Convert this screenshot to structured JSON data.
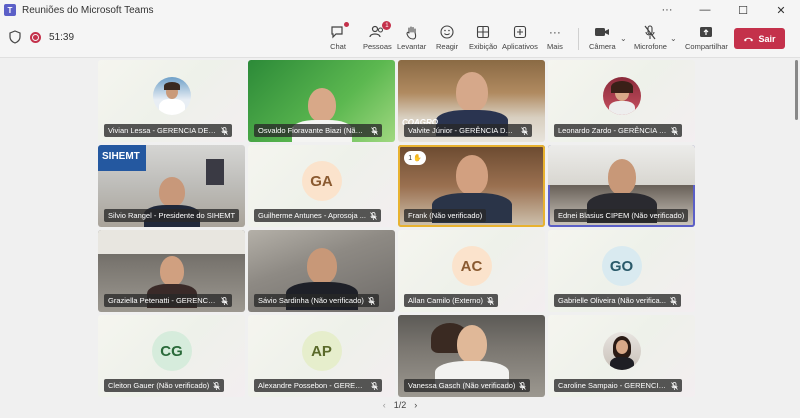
{
  "window": {
    "title": "Reuniões do Microsoft Teams",
    "app_icon": "teams-icon"
  },
  "toolbar": {
    "timer": "51:39",
    "items": [
      {
        "label": "Chat",
        "icon": "chat-icon"
      },
      {
        "label": "Pessoas",
        "icon": "people-icon",
        "badge": "1"
      },
      {
        "label": "Levantar",
        "icon": "raise-hand-icon"
      },
      {
        "label": "Reagir",
        "icon": "react-icon"
      },
      {
        "label": "Exibição",
        "icon": "view-icon"
      },
      {
        "label": "Aplicativos",
        "icon": "apps-icon"
      },
      {
        "label": "Mais",
        "icon": "more-icon"
      },
      {
        "label": "Câmera",
        "icon": "camera-icon"
      },
      {
        "label": "Microfone",
        "icon": "mic-icon"
      },
      {
        "label": "Compartilhar",
        "icon": "share-icon"
      }
    ],
    "leave_label": "Sair",
    "leave_color": "#c4314b"
  },
  "participants": [
    {
      "name": "Vivian Lessa - GERENCIA DE C...",
      "type": "avatar-photo",
      "muted": true
    },
    {
      "name": "Osvaldo Fioravante Biazi (Não ...",
      "type": "video",
      "muted": true
    },
    {
      "name": "Valvite Júnior - GERÊNCIA DE E...",
      "type": "video",
      "muted": true,
      "overlay": "COAGRO"
    },
    {
      "name": "Leonardo Zardo - GERÊNCIA D...",
      "type": "avatar-photo",
      "muted": true
    },
    {
      "name": "Silvio Rangel - Presidente do SIHEMT",
      "type": "video",
      "muted": false,
      "overlay": "SIHEMT"
    },
    {
      "name": "Guilherme Antunes - Aprosoja ...",
      "type": "initials",
      "initials": "GA",
      "muted": true
    },
    {
      "name": "Frank (Não verificado)",
      "type": "video",
      "muted": false,
      "raised_hand": "1"
    },
    {
      "name": "Ednei Blasius CIPEM (Não verificado)",
      "type": "video",
      "muted": false
    },
    {
      "name": "Graziella Petenatti - GERENCIA...",
      "type": "video",
      "muted": true
    },
    {
      "name": "Sávio Sardinha (Não verificado)",
      "type": "video",
      "muted": true
    },
    {
      "name": "Allan Camilo (Externo)",
      "type": "initials",
      "initials": "AC",
      "muted": true
    },
    {
      "name": "Gabrielle Oliveira (Não verifica...",
      "type": "initials",
      "initials": "GO",
      "muted": true
    },
    {
      "name": "Cleiton Gauer (Não verificado)",
      "type": "initials",
      "initials": "CG",
      "muted": true
    },
    {
      "name": "Alexandre Possebon - GERENC...",
      "type": "initials",
      "initials": "AP",
      "muted": true
    },
    {
      "name": "Vanessa Gasch (Não verificado)",
      "type": "video",
      "muted": true
    },
    {
      "name": "Caroline Sampaio - GERENCIA ...",
      "type": "avatar-photo",
      "muted": true
    }
  ],
  "pager": {
    "label": "1/2"
  }
}
